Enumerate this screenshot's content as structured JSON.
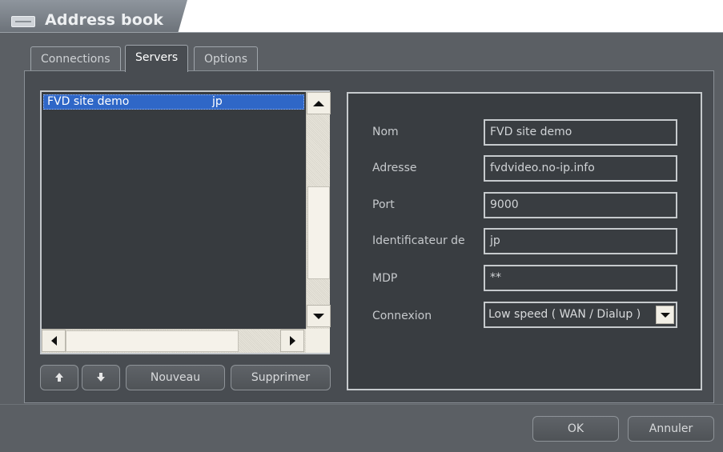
{
  "window": {
    "title": "Address book",
    "icon": "address-book-icon"
  },
  "tabs": [
    {
      "label": "Connections",
      "active": false
    },
    {
      "label": "Servers",
      "active": true
    },
    {
      "label": "Options",
      "active": false
    }
  ],
  "server_list": {
    "rows": [
      {
        "name": "FVD site demo",
        "user": "jp",
        "selected": true
      }
    ]
  },
  "list_buttons": {
    "move_up_icon": "arrow-up-icon",
    "move_down_icon": "arrow-down-icon",
    "new_label": "Nouveau",
    "delete_label": "Supprimer"
  },
  "details": {
    "nom": {
      "label": "Nom",
      "value": "FVD site demo"
    },
    "adresse": {
      "label": "Adresse",
      "value": "fvdvideo.no-ip.info"
    },
    "port": {
      "label": "Port",
      "value": "9000"
    },
    "identificateur": {
      "label": "Identificateur de",
      "value": "jp"
    },
    "mdp": {
      "label": "MDP",
      "value": "**"
    },
    "connexion": {
      "label": "Connexion",
      "value": "Low speed ( WAN / Dialup )"
    }
  },
  "footer": {
    "ok_label": "OK",
    "cancel_label": "Annuler"
  },
  "colors": {
    "frame": "#5b5f64",
    "panel": "#484c51",
    "selection": "#2f67c7"
  }
}
